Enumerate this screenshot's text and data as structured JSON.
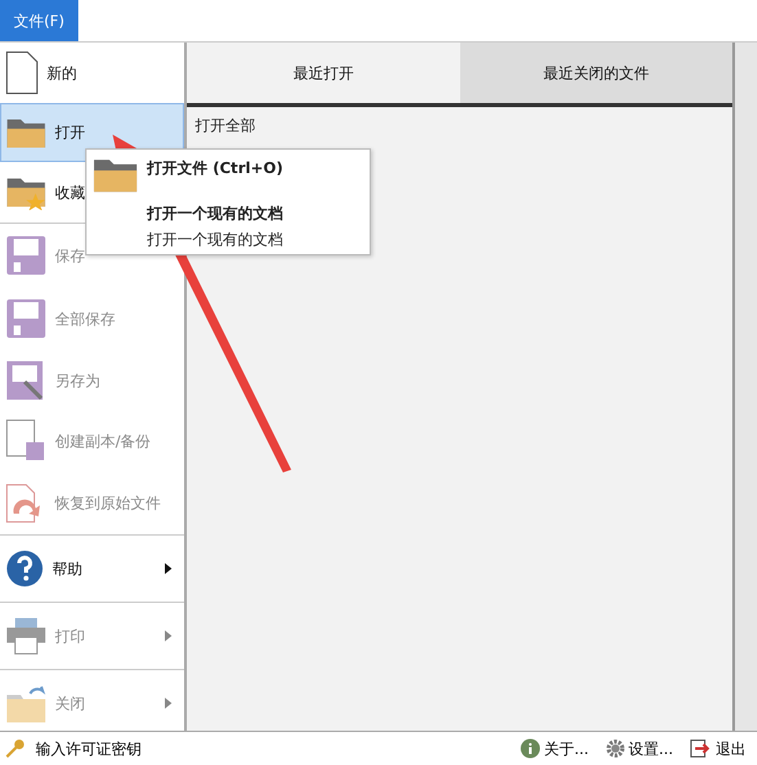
{
  "menu_bar": {
    "file_tab": {
      "label": "文件(F)",
      "selected": true
    }
  },
  "sidebar": {
    "groups": [
      {
        "items": [
          {
            "label": "新的",
            "selected": false,
            "disabled": false
          },
          {
            "label": "打开",
            "selected": true,
            "disabled": false
          },
          {
            "label": "收藏",
            "selected": false,
            "disabled": false
          }
        ]
      },
      {
        "items": [
          {
            "label": "保存",
            "selected": false,
            "disabled": true
          },
          {
            "label": "全部保存",
            "selected": false,
            "disabled": true
          },
          {
            "label": "另存为",
            "selected": false,
            "disabled": true
          },
          {
            "label": "创建副本/备份",
            "selected": false,
            "disabled": true
          },
          {
            "label": "恢复到原始文件",
            "selected": false,
            "disabled": true
          }
        ]
      },
      {
        "items": [
          {
            "label": "帮助",
            "selected": false,
            "disabled": false,
            "submenu": true
          }
        ]
      },
      {
        "items": [
          {
            "label": "打印",
            "selected": false,
            "disabled": true,
            "submenu": true
          }
        ]
      },
      {
        "items": [
          {
            "label": "关闭",
            "selected": false,
            "disabled": true,
            "submenu": true
          }
        ]
      }
    ]
  },
  "tabs": [
    {
      "label": "最近打开",
      "selected": true
    },
    {
      "label": "最近关闭的文件",
      "selected": false
    }
  ],
  "content": {
    "link": "打开全部"
  },
  "tooltip": {
    "title": "打开文件 (Ctrl+O)",
    "heading": "打开一个现有的文档",
    "description": "打开一个现有的文档"
  },
  "status_bar": {
    "license": "输入许可证密钥",
    "buttons": [
      "关于...",
      "设置...",
      "退出"
    ]
  }
}
